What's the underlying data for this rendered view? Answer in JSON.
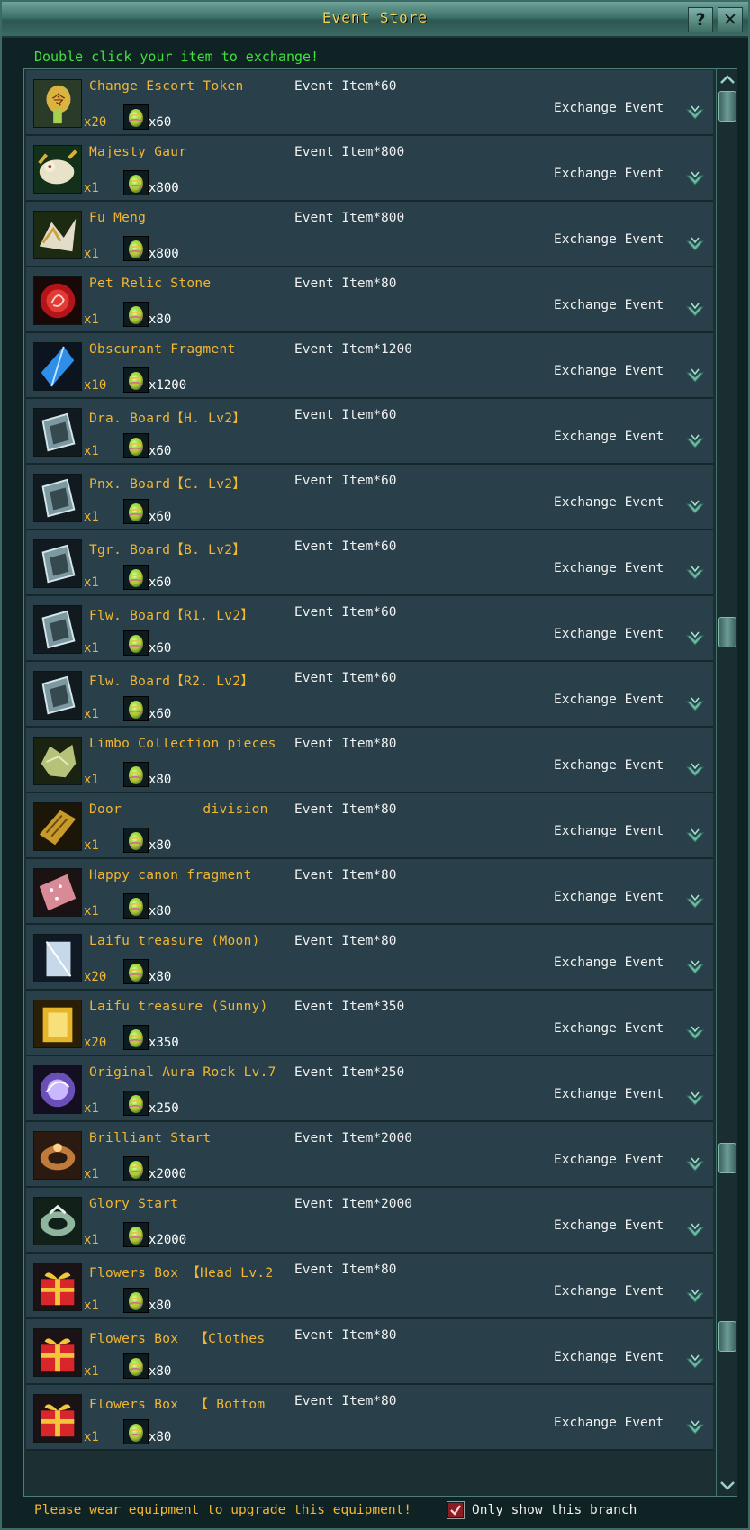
{
  "window": {
    "title": "Event Store",
    "help_label": "?",
    "close_label": "✕"
  },
  "hint": "Double click your item to exchange!",
  "colors": {
    "accent": "#f3b631",
    "hint": "#3fe23b",
    "row_bg": "#29404a",
    "title": "#f2d35a"
  },
  "items": [
    {
      "name": "Change Escort Token",
      "req": "Event Item*60",
      "qty": "x20",
      "cost": "x60",
      "action": "Exchange Event",
      "icon": "escort-token-icon"
    },
    {
      "name": "Majesty Gaur",
      "req": "Event Item*800",
      "qty": "x1",
      "cost": "x800",
      "action": "Exchange Event",
      "icon": "gaur-mount-icon"
    },
    {
      "name": "Fu Meng",
      "req": "Event Item*800",
      "qty": "x1",
      "cost": "x800",
      "action": "Exchange Event",
      "icon": "fu-meng-mount-icon"
    },
    {
      "name": "Pet Relic Stone",
      "req": "Event Item*80",
      "qty": "x1",
      "cost": "x80",
      "action": "Exchange Event",
      "icon": "relic-stone-icon"
    },
    {
      "name": "Obscurant Fragment",
      "req": "Event Item*1200",
      "qty": "x10",
      "cost": "x1200",
      "action": "Exchange Event",
      "icon": "crystal-fragment-icon"
    },
    {
      "name": "Dra. Board【H. Lv2】",
      "req": "Event Item*60",
      "qty": "x1",
      "cost": "x60",
      "action": "Exchange Event",
      "icon": "board-icon"
    },
    {
      "name": "Pnx. Board【C. Lv2】",
      "req": "Event Item*60",
      "qty": "x1",
      "cost": "x60",
      "action": "Exchange Event",
      "icon": "board-icon"
    },
    {
      "name": "Tgr. Board【B. Lv2】",
      "req": "Event Item*60",
      "qty": "x1",
      "cost": "x60",
      "action": "Exchange Event",
      "icon": "board-icon"
    },
    {
      "name": "Flw. Board【R1. Lv2】",
      "req": "Event Item*60",
      "qty": "x1",
      "cost": "x60",
      "action": "Exchange Event",
      "icon": "board-icon"
    },
    {
      "name": "Flw. Board【R2. Lv2】",
      "req": "Event Item*60",
      "qty": "x1",
      "cost": "x60",
      "action": "Exchange Event",
      "icon": "board-icon"
    },
    {
      "name": "Limbo Collection pieces",
      "req": "Event Item*80",
      "qty": "x1",
      "cost": "x80",
      "action": "Exchange Event",
      "icon": "limbo-pieces-icon"
    },
    {
      "name": "Door          division",
      "req": "Event Item*80",
      "qty": "x1",
      "cost": "x80",
      "action": "Exchange Event",
      "icon": "scroll-icon"
    },
    {
      "name": "Happy canon fragment",
      "req": "Event Item*80",
      "qty": "x1",
      "cost": "x80",
      "action": "Exchange Event",
      "icon": "canon-fragment-icon"
    },
    {
      "name": "Laifu treasure (Moon)",
      "req": "Event Item*80",
      "qty": "x20",
      "cost": "x80",
      "action": "Exchange Event",
      "icon": "moon-treasure-icon"
    },
    {
      "name": "Laifu treasure (Sunny)",
      "req": "Event Item*350",
      "qty": "x20",
      "cost": "x350",
      "action": "Exchange Event",
      "icon": "sunny-treasure-icon"
    },
    {
      "name": "Original Aura Rock Lv.7",
      "req": "Event Item*250",
      "qty": "x1",
      "cost": "x250",
      "action": "Exchange Event",
      "icon": "aura-rock-icon"
    },
    {
      "name": "Brilliant Start",
      "req": "Event Item*2000",
      "qty": "x1",
      "cost": "x2000",
      "action": "Exchange Event",
      "icon": "brilliant-ring-icon"
    },
    {
      "name": "Glory Start",
      "req": "Event Item*2000",
      "qty": "x1",
      "cost": "x2000",
      "action": "Exchange Event",
      "icon": "glory-ring-icon"
    },
    {
      "name": "Flowers Box 【Head Lv.2",
      "req": "Event Item*80",
      "qty": "x1",
      "cost": "x80",
      "action": "Exchange Event",
      "icon": "gift-box-icon"
    },
    {
      "name": "Flowers Box  【Clothes",
      "req": "Event Item*80",
      "qty": "x1",
      "cost": "x80",
      "action": "Exchange Event",
      "icon": "gift-box-icon"
    },
    {
      "name": "Flowers Box  【 Bottom",
      "req": "Event Item*80",
      "qty": "x1",
      "cost": "x80",
      "action": "Exchange Event",
      "icon": "gift-box-icon"
    }
  ],
  "footer": {
    "message": "Please wear equipment to upgrade this equipment!",
    "checkbox_label": "Only show this branch",
    "checkbox_checked": true
  }
}
